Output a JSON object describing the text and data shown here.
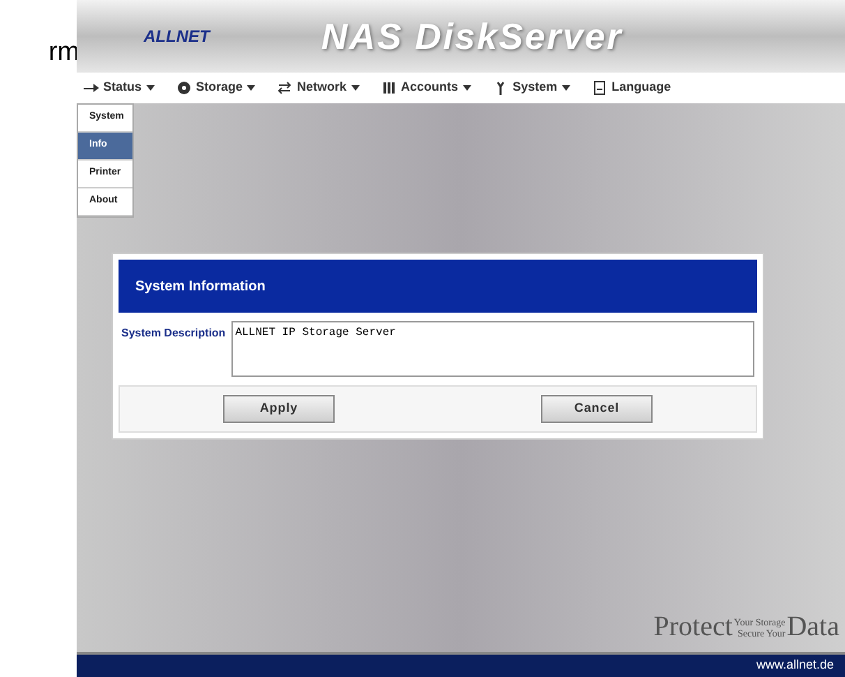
{
  "outside_text": "rm",
  "header": {
    "logo": "ALLNET",
    "title": "NAS DiskServer"
  },
  "menu": [
    {
      "label": "Status"
    },
    {
      "label": "Storage"
    },
    {
      "label": "Network"
    },
    {
      "label": "Accounts"
    },
    {
      "label": "System"
    },
    {
      "label": "Language"
    }
  ],
  "submenu": [
    {
      "label": "System",
      "selected": false
    },
    {
      "label": "Info",
      "selected": true
    },
    {
      "label": "Printer",
      "selected": false
    },
    {
      "label": "About",
      "selected": false
    }
  ],
  "dialog": {
    "title": "System Information",
    "field_label": "System Description",
    "value": "ALLNET IP Storage Server",
    "buttons": [
      "Apply",
      "Cancel"
    ]
  },
  "slogan": {
    "big1": "Protect",
    "small1": "Your Storage",
    "small2": "Secure Your",
    "big2": "Data"
  },
  "footer": "www.allnet.de"
}
